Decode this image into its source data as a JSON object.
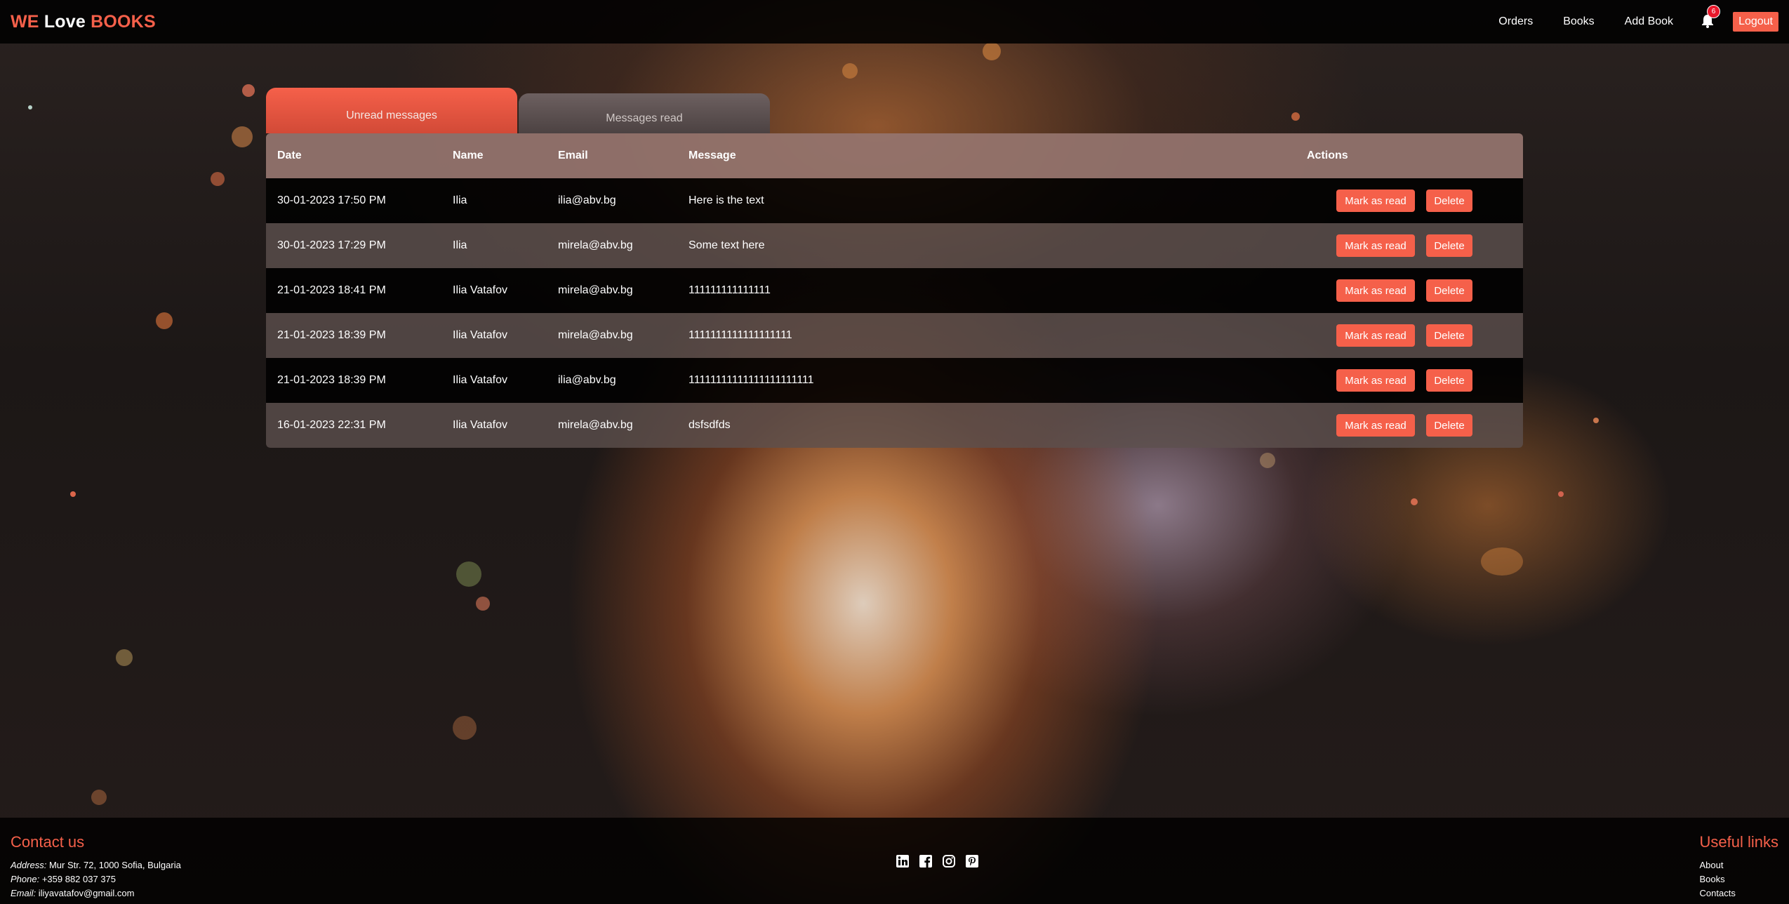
{
  "brand": {
    "part1": "WE",
    "part2": "Love",
    "part3": "BOOKS"
  },
  "nav": {
    "links": [
      "Orders",
      "Books",
      "Add Book"
    ],
    "notification_count": "6",
    "logout_label": "Logout"
  },
  "tabs": {
    "unread_label": "Unread messages",
    "read_label": "Messages read",
    "active": "unread"
  },
  "table": {
    "headers": {
      "date": "Date",
      "name": "Name",
      "email": "Email",
      "message": "Message",
      "actions": "Actions"
    },
    "rows": [
      {
        "date": "30-01-2023 17:50 PM",
        "name": "Ilia",
        "email": "ilia@abv.bg",
        "message": "Here is the text"
      },
      {
        "date": "30-01-2023 17:29 PM",
        "name": "Ilia",
        "email": "mirela@abv.bg",
        "message": "Some text here"
      },
      {
        "date": "21-01-2023 18:41 PM",
        "name": "Ilia Vatafov",
        "email": "mirela@abv.bg",
        "message": "111111111111111"
      },
      {
        "date": "21-01-2023 18:39 PM",
        "name": "Ilia Vatafov",
        "email": "mirela@abv.bg",
        "message": "1111111111111111111"
      },
      {
        "date": "21-01-2023 18:39 PM",
        "name": "Ilia Vatafov",
        "email": "ilia@abv.bg",
        "message": "11111111111111111111111"
      },
      {
        "date": "16-01-2023 22:31 PM",
        "name": "Ilia Vatafov",
        "email": "mirela@abv.bg",
        "message": "dsfsdfds"
      }
    ],
    "mark_read_label": "Mark as read",
    "delete_label": "Delete"
  },
  "footer": {
    "contact": {
      "heading": "Contact us",
      "address_label": "Address:",
      "address": "Mur Str. 72, 1000 Sofia, Bulgaria",
      "phone_label": "Phone:",
      "phone": "+359 882 037 375",
      "email_label": "Email:",
      "email": "iliyavatafov@gmail.com"
    },
    "socials": [
      "linkedin-icon",
      "facebook-icon",
      "instagram-icon",
      "pinterest-icon"
    ],
    "useful_links": {
      "heading": "Useful links",
      "items": [
        "About",
        "Books",
        "Contacts"
      ]
    }
  },
  "colors": {
    "accent": "#f5604a",
    "navbar": "#000000",
    "header_row": "#94746e",
    "badge": "#e8182b"
  }
}
